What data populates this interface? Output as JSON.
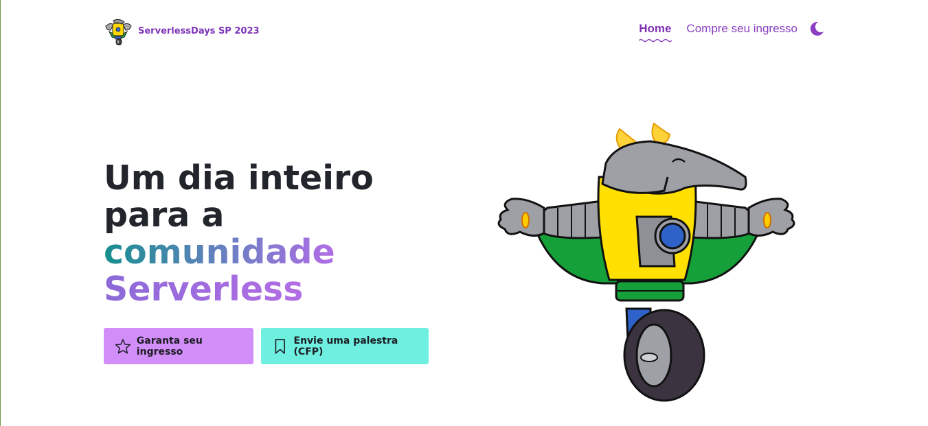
{
  "brand": {
    "name": "ServerlessDays SP 2023",
    "logo_icon": "tamandua-robot-logo"
  },
  "nav": {
    "items": [
      {
        "label": "Home",
        "active": true
      },
      {
        "label": "Compre seu ingresso",
        "active": false
      }
    ],
    "theme_toggle_icon": "moon-icon"
  },
  "hero": {
    "title_lines": [
      "Um dia inteiro",
      "para a",
      "comunidade",
      "Serverless"
    ],
    "buttons": [
      {
        "label": "Garanta seu ingresso",
        "icon": "star-icon"
      },
      {
        "label": "Envie uma palestra (CFP)",
        "icon": "bookmark-icon"
      }
    ],
    "illustration": "tamandua-robot-mascot"
  },
  "colors": {
    "brand_purple": "#7e34b8",
    "primary_button": "#d28ef8",
    "secondary_button": "#6eefe0",
    "heading": "#22252b"
  }
}
